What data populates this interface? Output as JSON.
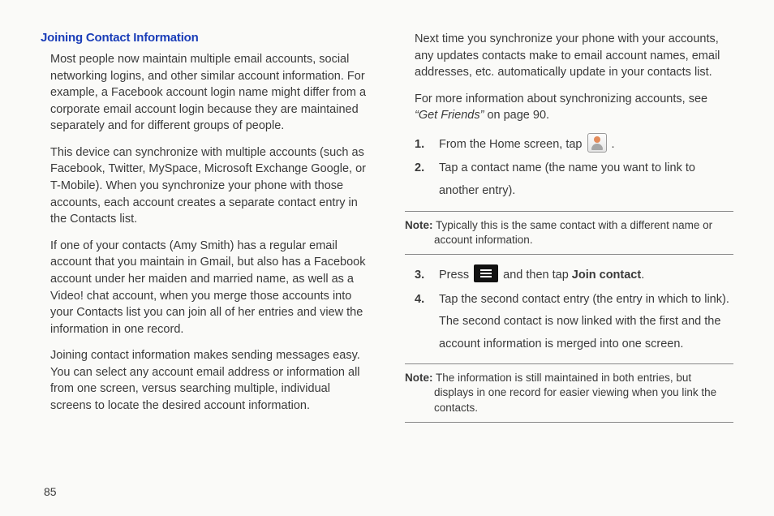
{
  "left": {
    "heading": "Joining Contact Information",
    "p1": "Most people now maintain multiple email accounts, social networking logins, and other similar account information. For example, a Facebook account login name might differ from a corporate email account login because they are maintained separately and for different groups of people.",
    "p2": "This device can synchronize with multiple accounts (such as Facebook, Twitter, MySpace, Microsoft Exchange Google, or T-Mobile). When you synchronize your phone with those accounts, each account creates a separate contact entry in the Contacts list.",
    "p3": "If one of your contacts (Amy Smith) has a regular email account that you maintain in Gmail, but also has a Facebook account under her maiden and married name, as well as a Video! chat account, when you merge those accounts into your Contacts list you can join all of her entries and view the information in one record.",
    "p4": "Joining contact information makes sending messages easy. You can select any account email address or information all from one screen, versus searching multiple, individual screens to locate the desired account information."
  },
  "right": {
    "p1": "Next time you synchronize your phone with your accounts, any updates contacts make to email account names, email addresses, etc. automatically update in your contacts list.",
    "p2_pre": "For more information about synchronizing accounts, see ",
    "p2_ital": "“Get Friends”",
    "p2_post": " on page 90.",
    "steps_a": {
      "s1_num": "1.",
      "s1_pre": "From the Home screen, tap ",
      "s1_post": " .",
      "s2_num": "2.",
      "s2": "Tap a contact name (the name you want to link to another entry)."
    },
    "note1_label": "Note:",
    "note1_body": " Typically this is the same contact with a different name or account information.",
    "steps_b": {
      "s3_num": "3.",
      "s3_pre": "Press ",
      "s3_mid": " and then tap ",
      "s3_bold": "Join contact",
      "s3_post": ".",
      "s4_num": "4.",
      "s4": "Tap the second contact entry (the entry in which to link). The second contact is now linked with the first and the account information is merged into one screen."
    },
    "note2_label": "Note:",
    "note2_body": " The information is still maintained in both entries, but displays in one record for easier viewing when you link the contacts."
  },
  "page_number": "85"
}
